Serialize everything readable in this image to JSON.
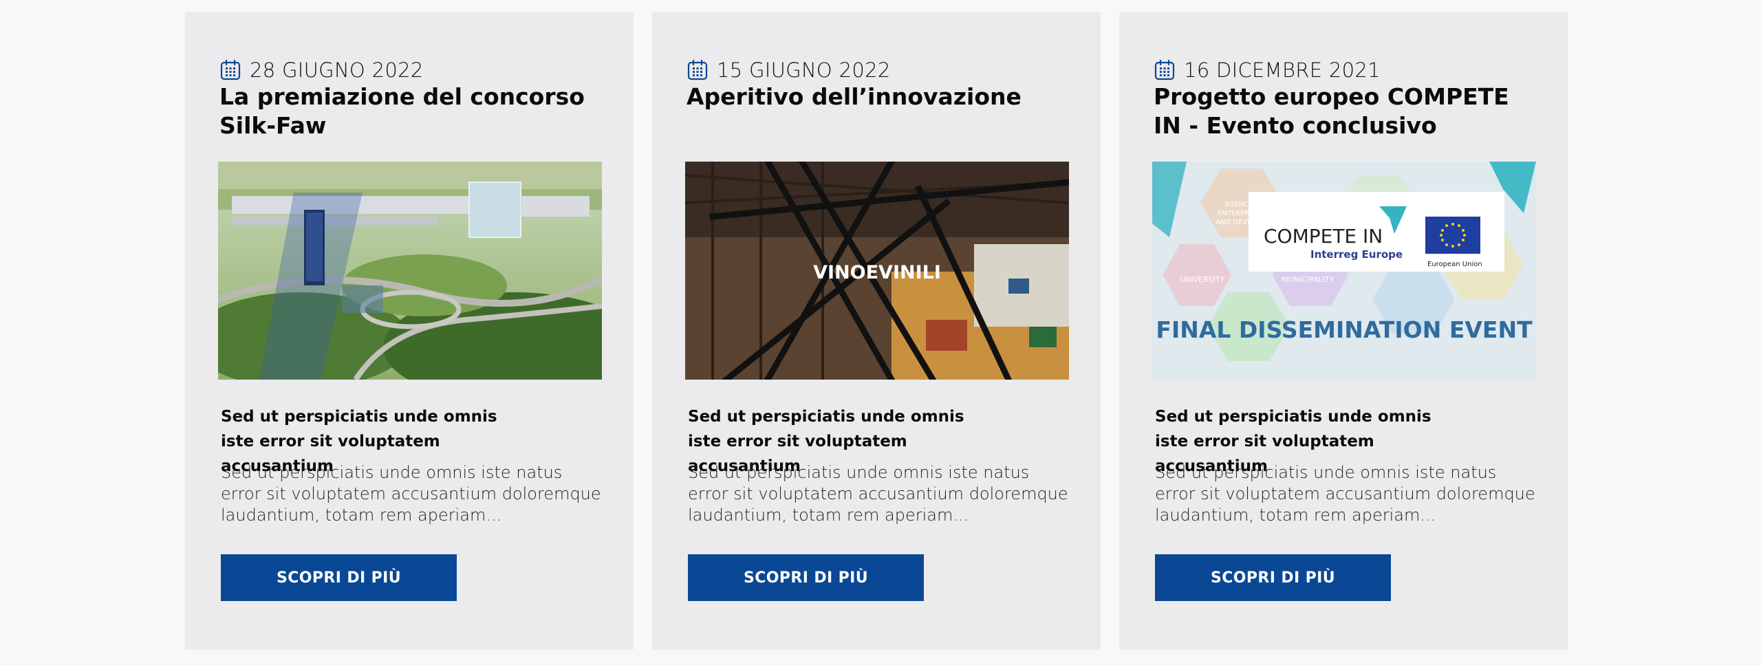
{
  "cards": [
    {
      "date": "28 GIUGNO 2022",
      "title": "La premiazione del concorso Silk-Faw",
      "image": "aerial-campus-render",
      "subtitle": "Sed ut perspiciatis unde omnis iste error sit voluptatem accusantium",
      "excerpt": "Sed ut perspiciatis unde omnis iste natus error sit voluptatem accusantium doloremque laudantium, totam rem aperiam...",
      "cta_label": "SCOPRI DI PIÙ"
    },
    {
      "date": "15 GIUGNO 2022",
      "title": "Aperitivo dell’innovazione",
      "image": "industrial-hall-photo",
      "image_text": "VINOEVINILI",
      "subtitle": "Sed ut perspiciatis unde omnis iste error sit voluptatem accusantium",
      "excerpt": "Sed ut perspiciatis unde omnis iste natus error sit voluptatem accusantium doloremque laudantium, totam rem aperiam...",
      "cta_label": "SCOPRI DI PIÙ"
    },
    {
      "date": "16 DICEMBRE 2021",
      "title": "Progetto europeo COMPETE IN - Evento conclusivo",
      "image": "compete-in-banner",
      "image_text": {
        "brand": "COMPETE IN",
        "sub": "Interreg Europe",
        "eu": "European Union",
        "headline": "FINAL DISSEMINATION EVENT",
        "hex_labels": [
          "UNIVERSITY",
          "MUNICIPALITY",
          "AGENCY",
          "ENTERPRISE",
          "AND DEVELO"
        ]
      },
      "subtitle": "Sed ut perspiciatis unde omnis iste error sit voluptatem accusantium",
      "excerpt": "Sed ut perspiciatis unde omnis iste natus error sit voluptatem accusantium doloremque laudantium, totam rem aperiam...",
      "cta_label": "SCOPRI DI PIÙ"
    }
  ],
  "icon": "calendar-icon",
  "colors": {
    "accent": "#0a4896",
    "card_bg": "#ebebed",
    "page_bg": "#f8f8fb"
  }
}
